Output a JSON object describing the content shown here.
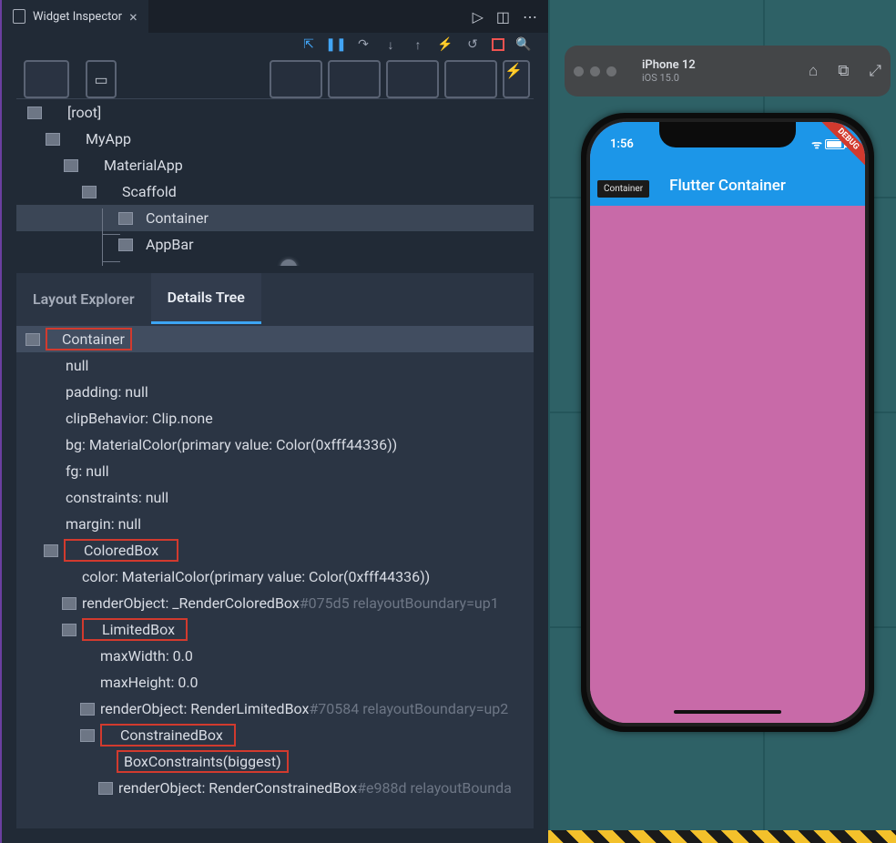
{
  "tabTitle": "Widget Inspector",
  "simulator": {
    "device": "iPhone 12",
    "os": "iOS 15.0"
  },
  "phone": {
    "time": "1:56",
    "appTitle": "Flutter Container",
    "bodyLabel": "Container",
    "debug": "DEBUG"
  },
  "widgetTree": {
    "root": "[root]",
    "n1": "MyApp",
    "n2": "MaterialApp",
    "n3": "Scaffold",
    "n4": "Container",
    "n5": "AppBar"
  },
  "subTabs": {
    "layout": "Layout Explorer",
    "details": "Details Tree"
  },
  "details": {
    "container": "Container",
    "p_null": "null",
    "p_padding": "padding: null",
    "p_clip": "clipBehavior: Clip.none",
    "p_bg": "bg: MaterialColor(primary value: Color(0xfff44336))",
    "p_fg": "fg: null",
    "p_constraints": "constraints: null",
    "p_margin": "margin: null",
    "coloredBox": "ColoredBox",
    "p_color": "color: MaterialColor(primary value: Color(0xfff44336))",
    "ro1a": "renderObject: _RenderColoredBox",
    "ro1b": "#075d5 relayoutBoundary=up1",
    "limitedBox": "LimitedBox",
    "p_maxW": "maxWidth: 0.0",
    "p_maxH": "maxHeight: 0.0",
    "ro2a": "renderObject: RenderLimitedBox",
    "ro2b": "#70584 relayoutBoundary=up2",
    "constrainedBox": "ConstrainedBox",
    "boxConstraints": "BoxConstraints(biggest)",
    "ro3a": "renderObject: RenderConstrainedBox",
    "ro3b": "#e988d relayoutBounda"
  }
}
